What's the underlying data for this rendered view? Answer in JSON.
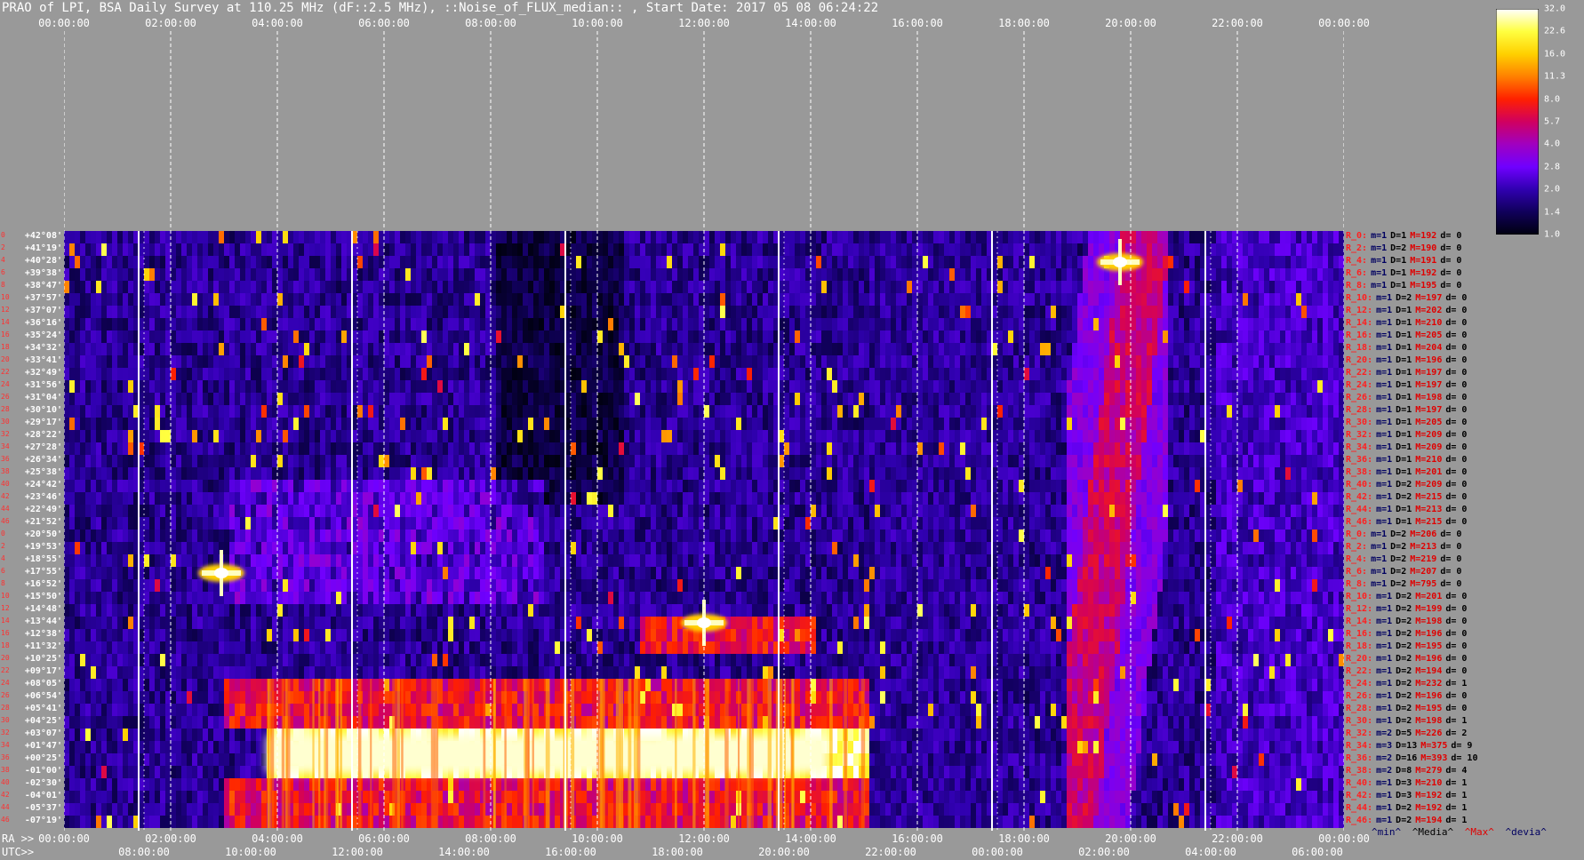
{
  "title": "PRAO of LPI, BSA Daily Survey at 110.25 MHz (dF::2.5 MHz), ::Noise_of_FLUX_median:: , Start Date: 2017 05 08 06:24:22",
  "bottom_axis": {
    "ra_prefix": "RA >>",
    "utc_prefix": "UTC>>",
    "ra_ticks": [
      "00:00:00",
      "02:00:00",
      "04:00:00",
      "06:00:00",
      "08:00:00",
      "10:00:00",
      "12:00:00",
      "14:00:00",
      "16:00:00",
      "18:00:00",
      "20:00:00",
      "22:00:00",
      "00:00:00"
    ],
    "utc_ticks": [
      "08:00:00",
      "10:00:00",
      "12:00:00",
      "14:00:00",
      "16:00:00",
      "18:00:00",
      "20:00:00",
      "22:00:00",
      "00:00:00",
      "02:00:00",
      "04:00:00",
      "06:00:00"
    ]
  },
  "row_indices": [
    "0",
    "2",
    "4",
    "6",
    "8",
    "10",
    "12",
    "14",
    "16",
    "18",
    "20",
    "22",
    "24",
    "26",
    "28",
    "30",
    "32",
    "34",
    "36",
    "38",
    "40",
    "42",
    "44",
    "46",
    "0",
    "2",
    "4",
    "6",
    "8",
    "10",
    "12",
    "14",
    "16",
    "18",
    "20",
    "22",
    "24",
    "26",
    "28",
    "30",
    "32",
    "34",
    "36",
    "38",
    "40",
    "42",
    "44",
    "46"
  ],
  "declinations": [
    "+42°08'",
    "+41°19'",
    "+40°28'",
    "+39°38'",
    "+38°47'",
    "+37°57'",
    "+37°07'",
    "+36°16'",
    "+35°24'",
    "+34°32'",
    "+33°41'",
    "+32°49'",
    "+31°56'",
    "+31°04'",
    "+30°10'",
    "+29°17'",
    "+28°22'",
    "+27°28'",
    "+26°34'",
    "+25°38'",
    "+24°42'",
    "+23°46'",
    "+22°49'",
    "+21°52'",
    "+20°50'",
    "+19°53'",
    "+18°55'",
    "+17°55'",
    "+16°52'",
    "+15°50'",
    "+14°48'",
    "+13°44'",
    "+12°38'",
    "+11°32'",
    "+10°25'",
    "+09°17'",
    "+08°05'",
    "+06°54'",
    "+05°41'",
    "+04°25'",
    "+03°07'",
    "+01°47'",
    "+00°25'",
    "-01°00'",
    "-02°30'",
    "-04°01'",
    "-05°37'",
    "-07°19'"
  ],
  "stats": [
    {
      "r": "R_0:",
      "m": "m=1",
      "d": "D=1",
      "x": "M=192",
      "v": "d= 0"
    },
    {
      "r": "R_2:",
      "m": "m=1",
      "d": "D=2",
      "x": "M=190",
      "v": "d= 0"
    },
    {
      "r": "R_4:",
      "m": "m=1",
      "d": "D=1",
      "x": "M=191",
      "v": "d= 0"
    },
    {
      "r": "R_6:",
      "m": "m=1",
      "d": "D=1",
      "x": "M=192",
      "v": "d= 0"
    },
    {
      "r": "R_8:",
      "m": "m=1",
      "d": "D=1",
      "x": "M=195",
      "v": "d= 0"
    },
    {
      "r": "R_10:",
      "m": "m=1",
      "d": "D=2",
      "x": "M=197",
      "v": "d= 0"
    },
    {
      "r": "R_12:",
      "m": "m=1",
      "d": "D=1",
      "x": "M=202",
      "v": "d= 0"
    },
    {
      "r": "R_14:",
      "m": "m=1",
      "d": "D=1",
      "x": "M=210",
      "v": "d= 0"
    },
    {
      "r": "R_16:",
      "m": "m=1",
      "d": "D=1",
      "x": "M=205",
      "v": "d= 0"
    },
    {
      "r": "R_18:",
      "m": "m=1",
      "d": "D=1",
      "x": "M=204",
      "v": "d= 0"
    },
    {
      "r": "R_20:",
      "m": "m=1",
      "d": "D=1",
      "x": "M=196",
      "v": "d= 0"
    },
    {
      "r": "R_22:",
      "m": "m=1",
      "d": "D=1",
      "x": "M=197",
      "v": "d= 0"
    },
    {
      "r": "R_24:",
      "m": "m=1",
      "d": "D=1",
      "x": "M=197",
      "v": "d= 0"
    },
    {
      "r": "R_26:",
      "m": "m=1",
      "d": "D=1",
      "x": "M=198",
      "v": "d= 0"
    },
    {
      "r": "R_28:",
      "m": "m=1",
      "d": "D=1",
      "x": "M=197",
      "v": "d= 0"
    },
    {
      "r": "R_30:",
      "m": "m=1",
      "d": "D=1",
      "x": "M=205",
      "v": "d= 0"
    },
    {
      "r": "R_32:",
      "m": "m=1",
      "d": "D=1",
      "x": "M=209",
      "v": "d= 0"
    },
    {
      "r": "R_34:",
      "m": "m=1",
      "d": "D=1",
      "x": "M=209",
      "v": "d= 0"
    },
    {
      "r": "R_36:",
      "m": "m=1",
      "d": "D=1",
      "x": "M=210",
      "v": "d= 0"
    },
    {
      "r": "R_38:",
      "m": "m=1",
      "d": "D=1",
      "x": "M=201",
      "v": "d= 0"
    },
    {
      "r": "R_40:",
      "m": "m=1",
      "d": "D=2",
      "x": "M=209",
      "v": "d= 0"
    },
    {
      "r": "R_42:",
      "m": "m=1",
      "d": "D=2",
      "x": "M=215",
      "v": "d= 0"
    },
    {
      "r": "R_44:",
      "m": "m=1",
      "d": "D=1",
      "x": "M=213",
      "v": "d= 0"
    },
    {
      "r": "R_46:",
      "m": "m=1",
      "d": "D=1",
      "x": "M=215",
      "v": "d= 0"
    },
    {
      "r": "R_0:",
      "m": "m=1",
      "d": "D=2",
      "x": "M=206",
      "v": "d= 0"
    },
    {
      "r": "R_2:",
      "m": "m=1",
      "d": "D=2",
      "x": "M=213",
      "v": "d= 0"
    },
    {
      "r": "R_4:",
      "m": "m=1",
      "d": "D=2",
      "x": "M=219",
      "v": "d= 0"
    },
    {
      "r": "R_6:",
      "m": "m=1",
      "d": "D=2",
      "x": "M=207",
      "v": "d= 0"
    },
    {
      "r": "R_8:",
      "m": "m=1",
      "d": "D=2",
      "x": "M=795",
      "v": "d= 0"
    },
    {
      "r": "R_10:",
      "m": "m=1",
      "d": "D=2",
      "x": "M=201",
      "v": "d= 0"
    },
    {
      "r": "R_12:",
      "m": "m=1",
      "d": "D=2",
      "x": "M=199",
      "v": "d= 0"
    },
    {
      "r": "R_14:",
      "m": "m=1",
      "d": "D=2",
      "x": "M=198",
      "v": "d= 0"
    },
    {
      "r": "R_16:",
      "m": "m=1",
      "d": "D=2",
      "x": "M=196",
      "v": "d= 0"
    },
    {
      "r": "R_18:",
      "m": "m=1",
      "d": "D=2",
      "x": "M=195",
      "v": "d= 0"
    },
    {
      "r": "R_20:",
      "m": "m=1",
      "d": "D=2",
      "x": "M=196",
      "v": "d= 0"
    },
    {
      "r": "R_22:",
      "m": "m=1",
      "d": "D=2",
      "x": "M=194",
      "v": "d= 0"
    },
    {
      "r": "R_24:",
      "m": "m=1",
      "d": "D=2",
      "x": "M=232",
      "v": "d= 1"
    },
    {
      "r": "R_26:",
      "m": "m=1",
      "d": "D=2",
      "x": "M=196",
      "v": "d= 0"
    },
    {
      "r": "R_28:",
      "m": "m=1",
      "d": "D=2",
      "x": "M=195",
      "v": "d= 0"
    },
    {
      "r": "R_30:",
      "m": "m=1",
      "d": "D=2",
      "x": "M=198",
      "v": "d= 1"
    },
    {
      "r": "R_32:",
      "m": "m=2",
      "d": "D=5",
      "x": "M=226",
      "v": "d= 2"
    },
    {
      "r": "R_34:",
      "m": "m=3",
      "d": "D=13",
      "x": "M=375",
      "v": "d= 9"
    },
    {
      "r": "R_36:",
      "m": "m=2",
      "d": "D=16",
      "x": "M=393",
      "v": "d= 10"
    },
    {
      "r": "R_38:",
      "m": "m=2",
      "d": "D=8",
      "x": "M=279",
      "v": "d= 4"
    },
    {
      "r": "R_40:",
      "m": "m=1",
      "d": "D=3",
      "x": "M=210",
      "v": "d= 1"
    },
    {
      "r": "R_42:",
      "m": "m=1",
      "d": "D=3",
      "x": "M=192",
      "v": "d= 1"
    },
    {
      "r": "R_44:",
      "m": "m=1",
      "d": "D=2",
      "x": "M=192",
      "v": "d= 1"
    },
    {
      "r": "R_46:",
      "m": "m=1",
      "d": "D=2",
      "x": "M=194",
      "v": "d= 1"
    }
  ],
  "legend_footer": {
    "min": "^min^",
    "median": "^Media^",
    "max": "^Max^",
    "devia": "^devia^"
  },
  "colorbar": {
    "labels": [
      "32.0",
      "22.6",
      "16.0",
      "11.3",
      "8.0",
      "5.7",
      "4.0",
      "2.8",
      "2.0",
      "1.4",
      "1.0"
    ],
    "colors": [
      "#ffffff",
      "#ffff40",
      "#ffd000",
      "#ff8000",
      "#ff2000",
      "#d00060",
      "#a000c0",
      "#7000ff",
      "#3000b0",
      "#10005a",
      "#000010"
    ]
  },
  "colors": {
    "background": "#999999",
    "grid": "#ffffff",
    "label_red": "#ff2020",
    "dark_blue": "#000060"
  },
  "chart_data": {
    "type": "heatmap",
    "title": "PRAO of LPI, BSA Daily Survey at 110.25 MHz (dF::2.5 MHz), ::Noise_of_FLUX_median:: , Start Date: 2017 05 08 06:24:22",
    "xlabel": "RA >>",
    "x_range": [
      "00:00:00",
      "00:00:00"
    ],
    "y_categories_count": 48,
    "color_scale": {
      "min": 1.0,
      "max": 32.0,
      "scale": "log2"
    },
    "features": [
      {
        "type": "band",
        "decs": [
          "+03°07'",
          "+01°47'",
          "+00°25'",
          "-01°00'"
        ],
        "ra_start_h": 3.8,
        "ra_end_h": 15.0,
        "level": 32.0
      },
      {
        "type": "band",
        "decs": [
          "+08°05'",
          "+06°54'",
          "+05°41'",
          "+04°25'",
          "-02°30'",
          "-04°01'",
          "-05°37'",
          "-07°19'"
        ],
        "ra_start_h": 3.0,
        "ra_end_h": 15.0,
        "level": 8.0
      },
      {
        "type": "band",
        "decs": [
          "+13°44'",
          "+12°38'",
          "+11°32'"
        ],
        "ra_start_h": 10.8,
        "ra_end_h": 14.0,
        "level": 8.0
      },
      {
        "type": "spot",
        "dec": "+40°28'",
        "ra_h": 19.8,
        "level": 32.0
      },
      {
        "type": "spot",
        "dec": "+17°55'",
        "ra_h": 2.95,
        "level": 32.0
      },
      {
        "type": "spot",
        "dec": "+13°44'",
        "ra_h": 12.0,
        "level": 32.0
      },
      {
        "type": "diagonal",
        "ra_start_h": 18.8,
        "ra_end_h": 20.6,
        "level": 5.7
      }
    ]
  }
}
